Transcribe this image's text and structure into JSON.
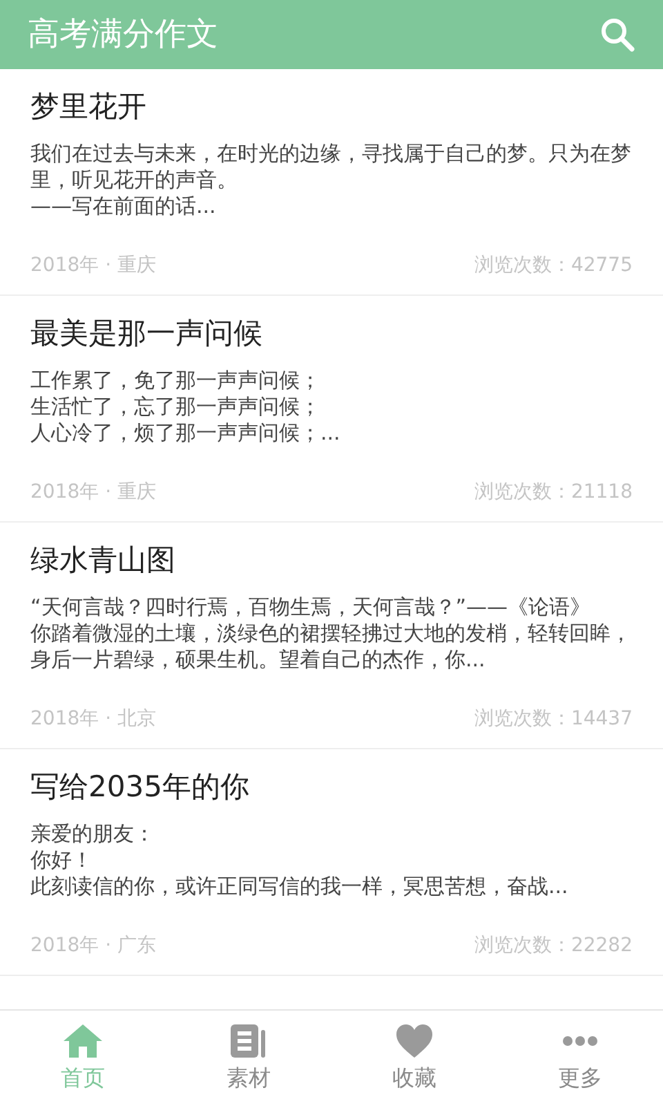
{
  "app_bar": {
    "title": "高考满分作文"
  },
  "articles": [
    {
      "title": "梦里花开",
      "summary_lines": [
        "我们在过去与未来，在时光的边缘，寻找属于自己的梦。只为在梦里，听见花开的声音。",
        "——写在前面的话..."
      ],
      "meta": "2018年 · 重庆",
      "views": "浏览次数：42775"
    },
    {
      "title": "最美是那一声问候",
      "summary_lines": [
        "工作累了，免了那一声声问候；",
        "生活忙了，忘了那一声声问候；",
        "人心冷了，烦了那一声声问候；..."
      ],
      "meta": "2018年 · 重庆",
      "views": "浏览次数：21118"
    },
    {
      "title": "绿水青山图",
      "summary_lines": [
        "“天何言哉？四时行焉，百物生焉，天何言哉？”——《论语》",
        "你踏着微湿的土壤，淡绿色的裙摆轻拂过大地的发梢，轻转回眸，身后一片碧绿，硕果生机。望着自己的杰作，你..."
      ],
      "meta": "2018年 · 北京",
      "views": "浏览次数：14437"
    },
    {
      "title": "写给2035年的你",
      "summary_lines": [
        "亲爱的朋友：",
        "你好！",
        "此刻读信的你，或许正同写信的我一样，冥思苦想，奋战..."
      ],
      "meta": "2018年 · 广东",
      "views": "浏览次数：22282"
    }
  ],
  "bottom_nav": [
    {
      "kind": "home",
      "label": "首页",
      "selected": true
    },
    {
      "kind": "material",
      "label": "素材",
      "selected": false
    },
    {
      "kind": "favorite",
      "label": "收藏",
      "selected": false
    },
    {
      "kind": "more",
      "label": "更多",
      "selected": false
    }
  ]
}
